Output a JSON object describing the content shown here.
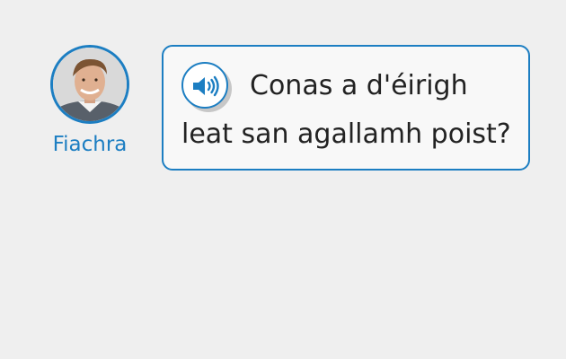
{
  "speaker": {
    "name": "Fiachra",
    "avatar_icon": "person-avatar"
  },
  "message": {
    "audio_icon": "speaker-volume-icon",
    "line1": "Conas a d'éirigh",
    "line2": "leat san agallamh poist?"
  },
  "colors": {
    "accent": "#1c7ec2",
    "background": "#efefef",
    "bubble": "#f8f8f8",
    "text": "#222222"
  }
}
